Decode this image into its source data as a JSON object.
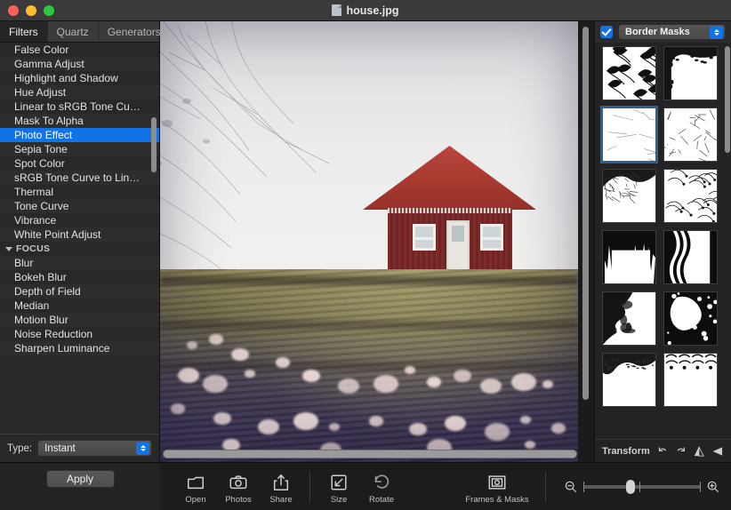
{
  "window": {
    "title": "house.jpg",
    "doc_icon": "document-icon",
    "traffic_lights": [
      "close",
      "minimize",
      "zoom"
    ]
  },
  "sidebar": {
    "tabs": [
      {
        "label": "Filters",
        "active": true
      },
      {
        "label": "Quartz",
        "active": false
      },
      {
        "label": "Generators",
        "active": false
      }
    ],
    "filters": [
      {
        "label": "False Color",
        "selected": false,
        "group": false
      },
      {
        "label": "Gamma Adjust",
        "selected": false,
        "group": false
      },
      {
        "label": "Highlight and Shadow",
        "selected": false,
        "group": false
      },
      {
        "label": "Hue Adjust",
        "selected": false,
        "group": false
      },
      {
        "label": "Linear to sRGB Tone Cu…",
        "selected": false,
        "group": false
      },
      {
        "label": "Mask To Alpha",
        "selected": false,
        "group": false
      },
      {
        "label": "Photo Effect",
        "selected": true,
        "group": false
      },
      {
        "label": "Sepia Tone",
        "selected": false,
        "group": false
      },
      {
        "label": "Spot Color",
        "selected": false,
        "group": false
      },
      {
        "label": "sRGB Tone Curve to Lin…",
        "selected": false,
        "group": false
      },
      {
        "label": "Thermal",
        "selected": false,
        "group": false
      },
      {
        "label": "Tone Curve",
        "selected": false,
        "group": false
      },
      {
        "label": "Vibrance",
        "selected": false,
        "group": false
      },
      {
        "label": "White Point Adjust",
        "selected": false,
        "group": false
      },
      {
        "label": "FOCUS",
        "selected": false,
        "group": true
      },
      {
        "label": "Blur",
        "selected": false,
        "group": false
      },
      {
        "label": "Bokeh Blur",
        "selected": false,
        "group": false
      },
      {
        "label": "Depth of Field",
        "selected": false,
        "group": false
      },
      {
        "label": "Median",
        "selected": false,
        "group": false
      },
      {
        "label": "Motion Blur",
        "selected": false,
        "group": false
      },
      {
        "label": "Noise Reduction",
        "selected": false,
        "group": false
      },
      {
        "label": "Sharpen Luminance",
        "selected": false,
        "group": false
      }
    ],
    "type_label": "Type:",
    "type_value": "Instant"
  },
  "mask_panel": {
    "enabled": true,
    "category": "Border Masks",
    "selected_index": 2,
    "thumbnails": [
      {
        "name": "floral-vine-mask"
      },
      {
        "name": "ornate-corner-frame-mask"
      },
      {
        "name": "light-scratches-mask"
      },
      {
        "name": "thin-branches-mask"
      },
      {
        "name": "dense-twigs-mask"
      },
      {
        "name": "dotted-sparkle-mask"
      },
      {
        "name": "torn-paint-strokes-mask"
      },
      {
        "name": "wavy-lines-mask"
      },
      {
        "name": "smoke-cloud-mask"
      },
      {
        "name": "splatter-ink-mask"
      },
      {
        "name": "brush-edge-mask"
      },
      {
        "name": "arc-pattern-mask"
      }
    ],
    "transform_label": "Transform",
    "transform_actions": [
      {
        "name": "rotate-left-icon"
      },
      {
        "name": "rotate-right-icon"
      },
      {
        "name": "flip-vertical-icon"
      },
      {
        "name": "flip-horizontal-icon"
      }
    ]
  },
  "toolbar": {
    "apply_label": "Apply",
    "tools": [
      {
        "label": "Open",
        "icon": "folder-icon"
      },
      {
        "label": "Photos",
        "icon": "camera-icon"
      },
      {
        "label": "Share",
        "icon": "share-icon"
      },
      {
        "label": "Size",
        "icon": "resize-icon"
      },
      {
        "label": "Rotate",
        "icon": "rotate-icon"
      },
      {
        "label": "Frames & Masks",
        "icon": "frame-icon"
      }
    ],
    "zoom_out_icon": "zoom-out-icon",
    "zoom_in_icon": "zoom-in-icon"
  },
  "canvas": {
    "image_alt": "house.jpg",
    "description": "Red wooden house with white windows on a grassy hillside with cotton grass, instant photo effect"
  }
}
